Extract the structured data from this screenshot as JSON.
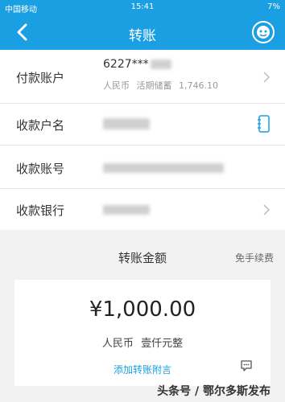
{
  "status_bar": {
    "carrier": "中国移动",
    "time": "15:41",
    "battery": "7%"
  },
  "header": {
    "title": "转账"
  },
  "form": {
    "payer": {
      "label": "付款账户",
      "account_prefix": "6227***",
      "currency": "人民币",
      "account_type": "活期储蓄",
      "balance": "1,746.10"
    },
    "payee_name": {
      "label": "收款户名"
    },
    "payee_account": {
      "label": "收款账号"
    },
    "payee_bank": {
      "label": "收款银行"
    }
  },
  "amount": {
    "title": "转账金额",
    "fee_note": "免手续费",
    "value": "¥1,000.00",
    "currency": "人民币",
    "in_words": "壹仟元整",
    "memo_link": "添加转账附言"
  },
  "watermark": "头条号 / 鄂尔多斯发布",
  "colors": {
    "accent": "#1a9fe3"
  }
}
